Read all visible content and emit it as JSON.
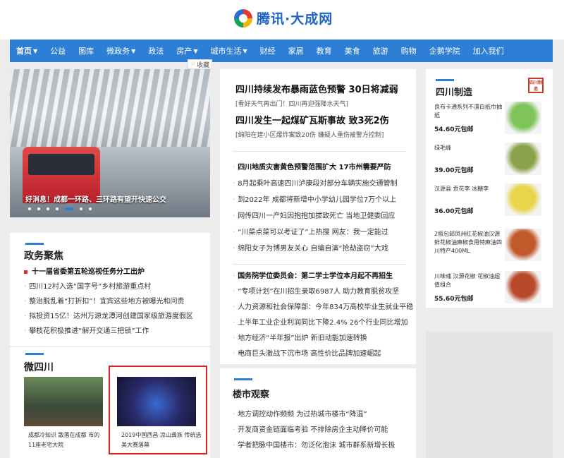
{
  "header": {
    "logo_text": "腾讯·大成网"
  },
  "nav": [
    {
      "label": "首页",
      "caret": true
    },
    {
      "label": "公益",
      "caret": false
    },
    {
      "label": "图库",
      "caret": false
    },
    {
      "label": "微政务",
      "caret": true
    },
    {
      "label": "政法",
      "caret": false
    },
    {
      "label": "房产",
      "caret": true
    },
    {
      "label": "城市生活",
      "caret": true
    },
    {
      "label": "财经",
      "caret": false
    },
    {
      "label": "家居",
      "caret": false
    },
    {
      "label": "教育",
      "caret": false
    },
    {
      "label": "美食",
      "caret": false
    },
    {
      "label": "旅游",
      "caret": false
    },
    {
      "label": "购物",
      "caret": false
    },
    {
      "label": "企鹅学院",
      "caret": false
    },
    {
      "label": "加入我们",
      "caret": false
    }
  ],
  "favorite_label": "收藏",
  "slider": {
    "caption": "好消息！成都一环路、三环路有望开快速公交",
    "dot_count": 7,
    "active_dot": 5
  },
  "politics": {
    "title": "政务聚焦",
    "items": [
      "十一届省委第五轮巡视任务分工出炉",
      "四川12村入选“国字号”乡村旅游重点村",
      "整治脱乱着“打折扣”！宜宾这些地方被曝光和问责",
      "拟投资15亿！达州万源龙潭河创建国家级旅游度假区",
      "攀枝花积极推进“解开交通三把锁”工作"
    ]
  },
  "weisichuan": {
    "title": "微四川",
    "items": [
      {
        "caption": "成都冷知识 散落在成都 市的11座老宅大院"
      },
      {
        "caption": "2019中国西昌·凉山彝族 传统选美大赛落幕"
      }
    ]
  },
  "news": {
    "headline1": "四川持续发布暴雨蓝色预警 30日将减弱",
    "sub1": "[看好天气再出门！四川再迎强降水天气]",
    "headline2": "四川发生一起煤矿瓦斯事故 致3死2伤",
    "sub2": "[绵阳在建小区爆炸案致20伤 嫌疑人重伤被警方控制]",
    "group1": [
      "四川地质灾害黄色预警范围扩大 17市州需要严防",
      "8月起乘叶高速四川泸康段对部分车辆实施交通管制",
      "到2022年 成都将新增中小学幼儿园学位7万个以上",
      "网传四川一产妇因抱抱加拔致死亡 当地卫健委回应",
      "“川菜点菜可以考证了”上热搜 网友：我一定能过",
      "绵阳女子为博男友关心 自编自演“抢劫盗窃”大戏"
    ],
    "group2": [
      "国务院学位委员会：第二学士学位本月起不再招生",
      "“专项计划”在川招生录取6987人 助力教育脱贫攻坚",
      "人力资源和社会保障部：今年834万高校毕业生就业平稳",
      "上半年工业企业利润同比下降2.4% 26个行业同比增加",
      "地方经济“半年报”出炉 新旧动能加速转换",
      "电商巨头激战下沉市场 高性价比品牌加速崛起"
    ]
  },
  "real_estate": {
    "title": "楼市观察",
    "items": [
      "地方调控动作频频 为过热城市楼市“降温”",
      "开发商资金链面临考验 不排除房企主动降价可能",
      "学者把脉中国楼市：勿泛化泡沫 城市群系新增长极"
    ]
  },
  "made_in_sichuan": {
    "title": "四川制造",
    "badge": "四川制造",
    "products": [
      {
        "name": "良布卡通系列不漂白纸巾抽纸",
        "price": "54.60元包邮",
        "color": "#7fc45a"
      },
      {
        "name": "绿毛峰",
        "price": "39.00元包邮",
        "color": "#8aa24a"
      },
      {
        "name": "汉源县 贡花李 冰糖李",
        "price": "36.00元包邮",
        "color": "#e8d64a"
      },
      {
        "name": "2瓶包邮凤洲红花椒油汉源鲜花椒油麻椒食用特麻油四川特产400ML",
        "price": "",
        "color": "#c05a2a"
      },
      {
        "name": "川味魂 汉源花椒 花椒油超值组合",
        "price": "55.60元包邮",
        "color": "#b8492a"
      }
    ]
  }
}
